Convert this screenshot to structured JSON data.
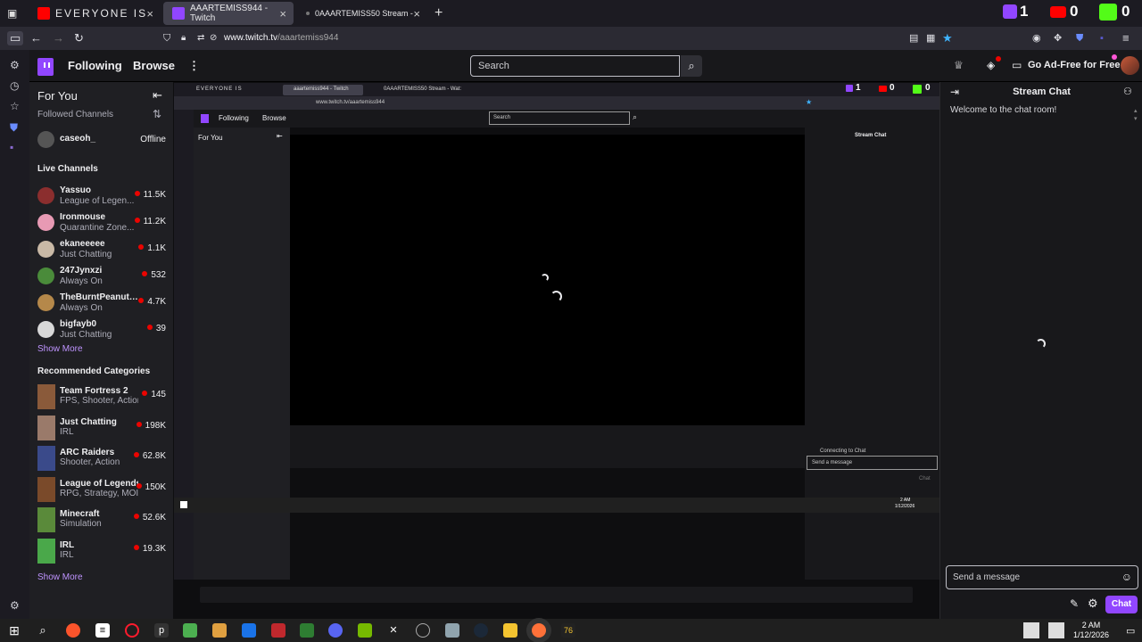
{
  "browser": {
    "tabs": [
      {
        "label": "EVERYONE IS",
        "active": false
      },
      {
        "label": "AAARTEMISS944 - Twitch",
        "active": true
      },
      {
        "label": "0AAARTEMISS50 Stream - Wat:",
        "active": false
      }
    ],
    "new_tab": "+",
    "url_host": "www.twitch.tv",
    "url_path": "/aaartemiss944",
    "overlay_counters": [
      {
        "icon": "twitch-icon",
        "value": "1",
        "color": "#9146ff"
      },
      {
        "icon": "youtube-icon",
        "value": "0",
        "color": "#ff0000"
      },
      {
        "icon": "kick-icon",
        "value": "0",
        "color": "#53fc18"
      }
    ]
  },
  "twitch_nav": {
    "following": "Following",
    "browse": "Browse",
    "more": "⋮",
    "search_placeholder": "Search",
    "ad_free": "Go Ad-Free for Free"
  },
  "sidebar": {
    "title": "For You",
    "followed_header": "Followed Channels",
    "followed": [
      {
        "name": "caseoh_",
        "status": "Offline",
        "color": "#555"
      }
    ],
    "live_header": "Live Channels",
    "live": [
      {
        "name": "Yassuo",
        "game": "League of Legen...",
        "viewers": "11.5K",
        "color": "#8b2e2e"
      },
      {
        "name": "Ironmouse",
        "game": "Quarantine Zone...",
        "viewers": "11.2K",
        "color": "#e89ab4"
      },
      {
        "name": "ekaneeeee",
        "game": "Just Chatting",
        "viewers": "1.1K",
        "color": "#c9b9a6"
      },
      {
        "name": "247Jynxzi",
        "game": "Always On",
        "viewers": "532",
        "color": "#4a8b3a"
      },
      {
        "name": "TheBurntPeanut_...",
        "game": "Always On",
        "viewers": "4.7K",
        "color": "#b5884a"
      },
      {
        "name": "bigfayb0",
        "game": "Just Chatting",
        "viewers": "39",
        "color": "#d8d8d8"
      }
    ],
    "show_more": "Show More",
    "recommended_header": "Recommended Categories",
    "categories": [
      {
        "name": "Team Fortress 2",
        "tags": "FPS, Shooter, Action",
        "viewers": "145",
        "color": "#8a5a3a"
      },
      {
        "name": "Just Chatting",
        "tags": "IRL",
        "viewers": "198K",
        "color": "#9a7a6a"
      },
      {
        "name": "ARC Raiders",
        "tags": "Shooter, Action",
        "viewers": "62.8K",
        "color": "#3a4a8a"
      },
      {
        "name": "League of Legends",
        "tags": "RPG, Strategy, MOI",
        "viewers": "150K",
        "color": "#7a4a2a"
      },
      {
        "name": "Minecraft",
        "tags": "Simulation",
        "viewers": "52.6K",
        "color": "#5a8a3a"
      },
      {
        "name": "IRL",
        "tags": "IRL",
        "viewers": "19.3K",
        "color": "#4aa84a"
      }
    ],
    "show_more_2": "Show More"
  },
  "nested": {
    "tabs": [
      "EVERYONE IS",
      "aaartemiss944 - Twitch",
      "0AAARTEMISS50 Stream - Wat:"
    ],
    "url": "www.twitch.tv/aaartemiss944",
    "following": "Following",
    "browse": "Browse",
    "search_placeholder": "Search",
    "for_you": "For You",
    "stream_chat": "Stream Chat",
    "connecting": "Connecting to Chat",
    "send_placeholder": "Send a message",
    "chat_btn": "Chat",
    "clock_time": "2 AM",
    "clock_date": "1/12/2026"
  },
  "chat": {
    "title": "Stream Chat",
    "welcome": "Welcome to the chat room!",
    "send_placeholder": "Send a message",
    "chat_button": "Chat"
  },
  "taskbar": {
    "clock_time": "2 AM",
    "clock_date": "1/12/2026"
  }
}
